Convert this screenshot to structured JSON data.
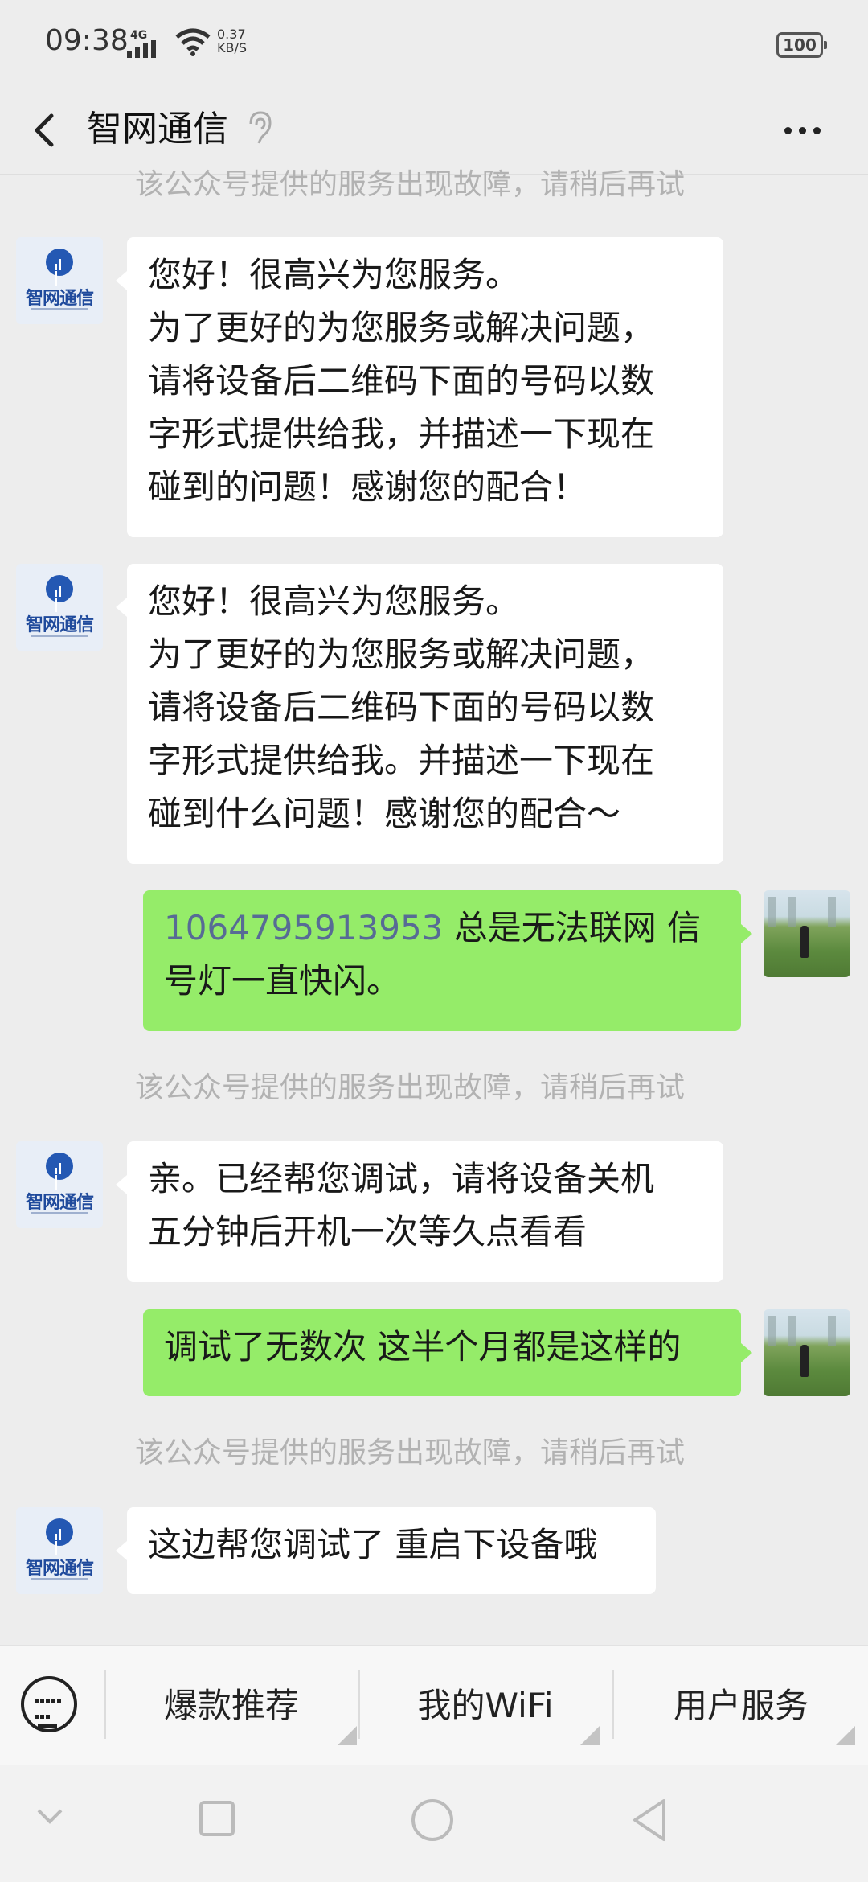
{
  "status_bar": {
    "time": "09:38",
    "network": "4G",
    "speed_value": "0.37",
    "speed_unit": "KB/S",
    "battery": "100"
  },
  "header": {
    "title": "智网通信",
    "back_icon": "chevron-left-icon",
    "ear_icon": "ear-icon",
    "more_icon": "more-dots-icon"
  },
  "messages": {
    "sys_1": "该公众号提供的服务出现故障，请稍后再试",
    "m1": "您好！很高兴为您服务。\n为了更好的为您服务或解决问题，请将设备后二维码下面的号码以数字形式提供给我，并描述一下现在碰到的问题！感谢您的配合！",
    "m1_lines": [
      "您好！很高兴为您服务。",
      "为了更好的为您服务或解决问题，",
      "请将设备后二维码下面的号码以数",
      "字形式提供给我，并描述一下现在",
      "碰到的问题！感谢您的配合！"
    ],
    "m2_lines": [
      "您好！很高兴为您服务。",
      "为了更好的为您服务或解决问题，",
      "请将设备后二维码下面的号码以数",
      "字形式提供给我。并描述一下现在",
      "碰到什么问题！感谢您的配合～"
    ],
    "m3_number": "1064795913953",
    "m3_text": " 总是无法联网 信号灯一直快闪。",
    "sys_2": "该公众号提供的服务出现故障，请稍后再试",
    "m4_lines": [
      "亲。已经帮您调试，请将设备关机",
      "五分钟后开机一次等久点看看"
    ],
    "m5": "调试了无数次 这半个月都是这样的",
    "sys_3": "该公众号提供的服务出现故障，请稍后再试",
    "m6": "这边帮您调试了 重启下设备哦"
  },
  "avatar": {
    "brand_name": "智网通信"
  },
  "menu": {
    "keyboard_icon": "keyboard-icon",
    "item_1": "爆款推荐",
    "item_2": "我的WiFi",
    "item_3": "用户服务"
  },
  "nav": {
    "icons": [
      "chevron-down-icon",
      "square-icon",
      "circle-icon",
      "triangle-back-icon"
    ]
  }
}
